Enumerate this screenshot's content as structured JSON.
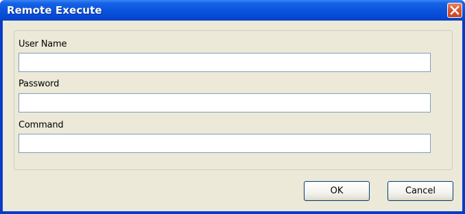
{
  "window": {
    "title": "Remote Execute"
  },
  "form": {
    "username": {
      "label": "User Name",
      "value": ""
    },
    "password": {
      "label": "Password",
      "value": ""
    },
    "command": {
      "label": "Command",
      "value": ""
    }
  },
  "buttons": {
    "ok_label": "OK",
    "cancel_label": "Cancel"
  },
  "icons": {
    "close": "close-icon"
  },
  "colors": {
    "titlebar": "#0a54dd",
    "close_button": "#d75a36",
    "dialog_background": "#ece9d8",
    "field_border": "#7f9db9",
    "button_border": "#003c74"
  }
}
